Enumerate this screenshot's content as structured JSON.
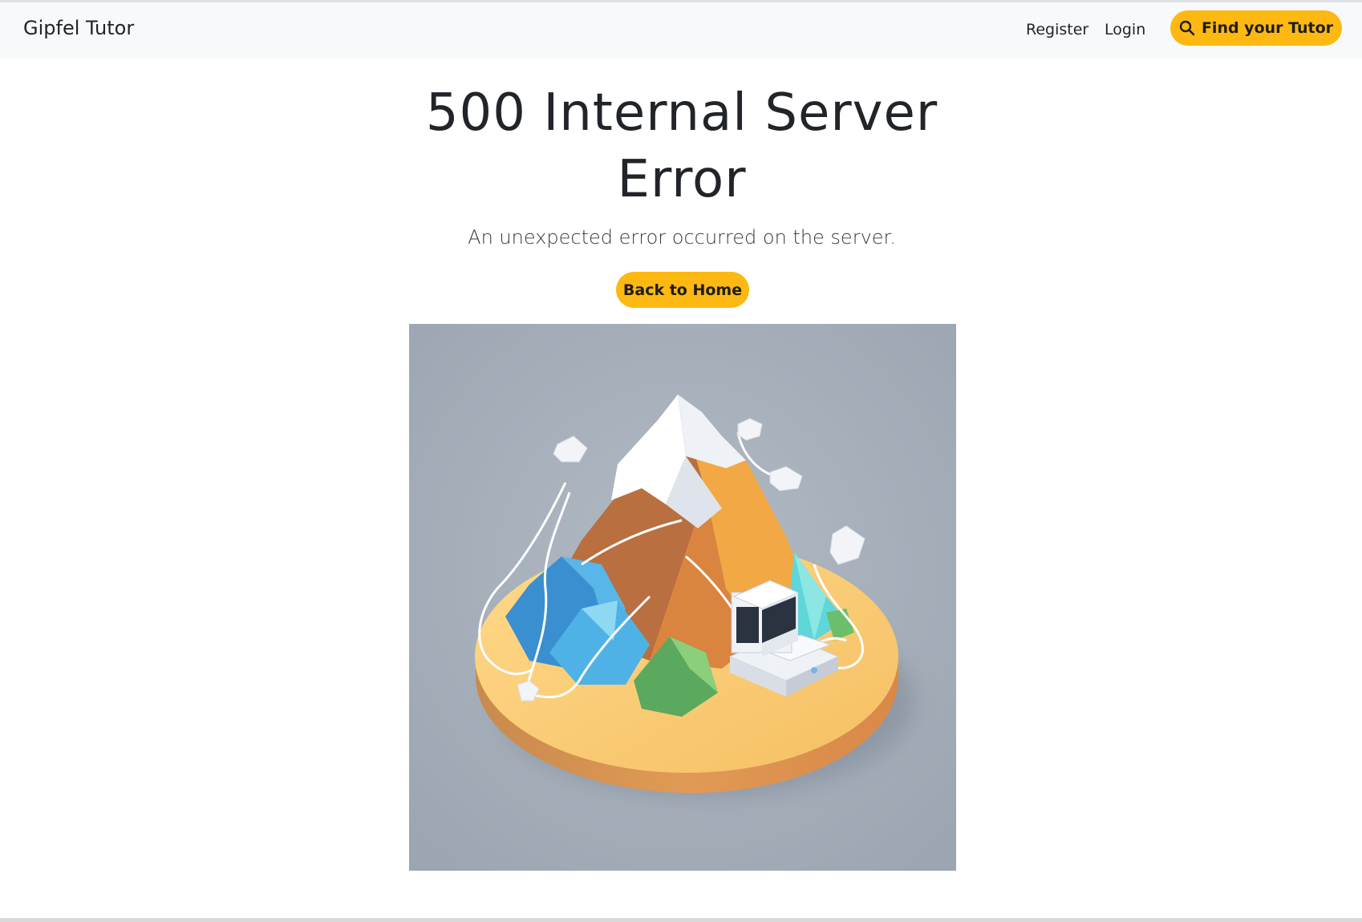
{
  "navbar": {
    "brand": "Gipfel Tutor",
    "register_label": "Register",
    "login_label": "Login",
    "find_tutor_label": "Find your Tutor",
    "find_tutor_icon": "search-icon"
  },
  "error": {
    "title": "500 Internal Server Error",
    "message": "An unexpected error occurred on the server.",
    "back_label": "Back to Home"
  },
  "colors": {
    "accent": "#fdb812",
    "navbar_bg": "#f8f9fa",
    "text": "#212529",
    "illustration_bg": "#a2acb6"
  }
}
